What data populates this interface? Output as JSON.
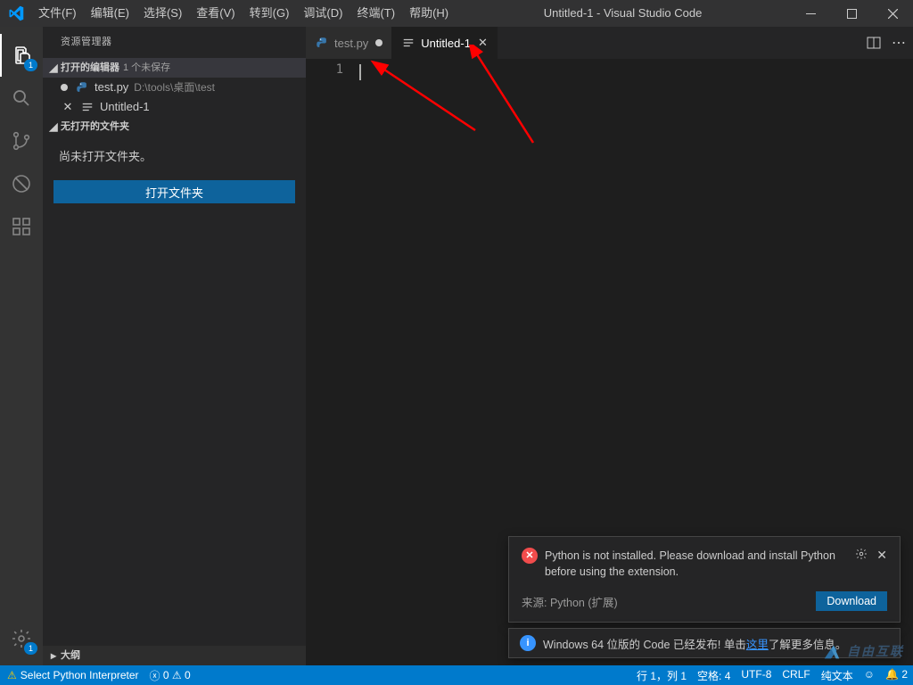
{
  "window": {
    "title": "Untitled-1 - Visual Studio Code"
  },
  "menu": [
    "文件(F)",
    "编辑(E)",
    "选择(S)",
    "查看(V)",
    "转到(G)",
    "调试(D)",
    "终端(T)",
    "帮助(H)"
  ],
  "activity": {
    "explorer_badge": "1",
    "settings_badge": "1"
  },
  "sidebar": {
    "title": "资源管理器",
    "open_editors_label": "打开的编辑器",
    "unsaved_tag": "1 个未保存",
    "files": [
      {
        "name": "test.py",
        "path": "D:\\tools\\桌面\\test",
        "dirty": true,
        "close": false
      },
      {
        "name": "Untitled-1",
        "path": "",
        "dirty": false,
        "close": true
      }
    ],
    "no_folder_header": "无打开的文件夹",
    "no_folder_msg": "尚未打开文件夹。",
    "open_folder_btn": "打开文件夹",
    "outline_label": "大纲"
  },
  "tabs": [
    {
      "name": "test.py",
      "active": false,
      "dirty": true,
      "type": "py"
    },
    {
      "name": "Untitled-1",
      "active": true,
      "dirty": false,
      "type": "txt"
    }
  ],
  "gutter": {
    "lines": [
      "1"
    ]
  },
  "notif1": {
    "msg": "Python is not installed. Please download and install Python before using the extension.",
    "source": "来源: Python (扩展)",
    "btn": "Download"
  },
  "notif2": {
    "prefix": "Windows 64 位版的 Code 已经发布! 单击",
    "link": "这里",
    "suffix": "了解更多信息。"
  },
  "status": {
    "interpreter": "Select Python Interpreter",
    "errors": "0",
    "warnings": "0",
    "ln_col": "行 1，列 1",
    "spaces": "空格: 4",
    "encoding": "UTF-8",
    "eol": "CRLF",
    "lang": "纯文本",
    "bell": "2"
  },
  "watermark": "自由互联"
}
